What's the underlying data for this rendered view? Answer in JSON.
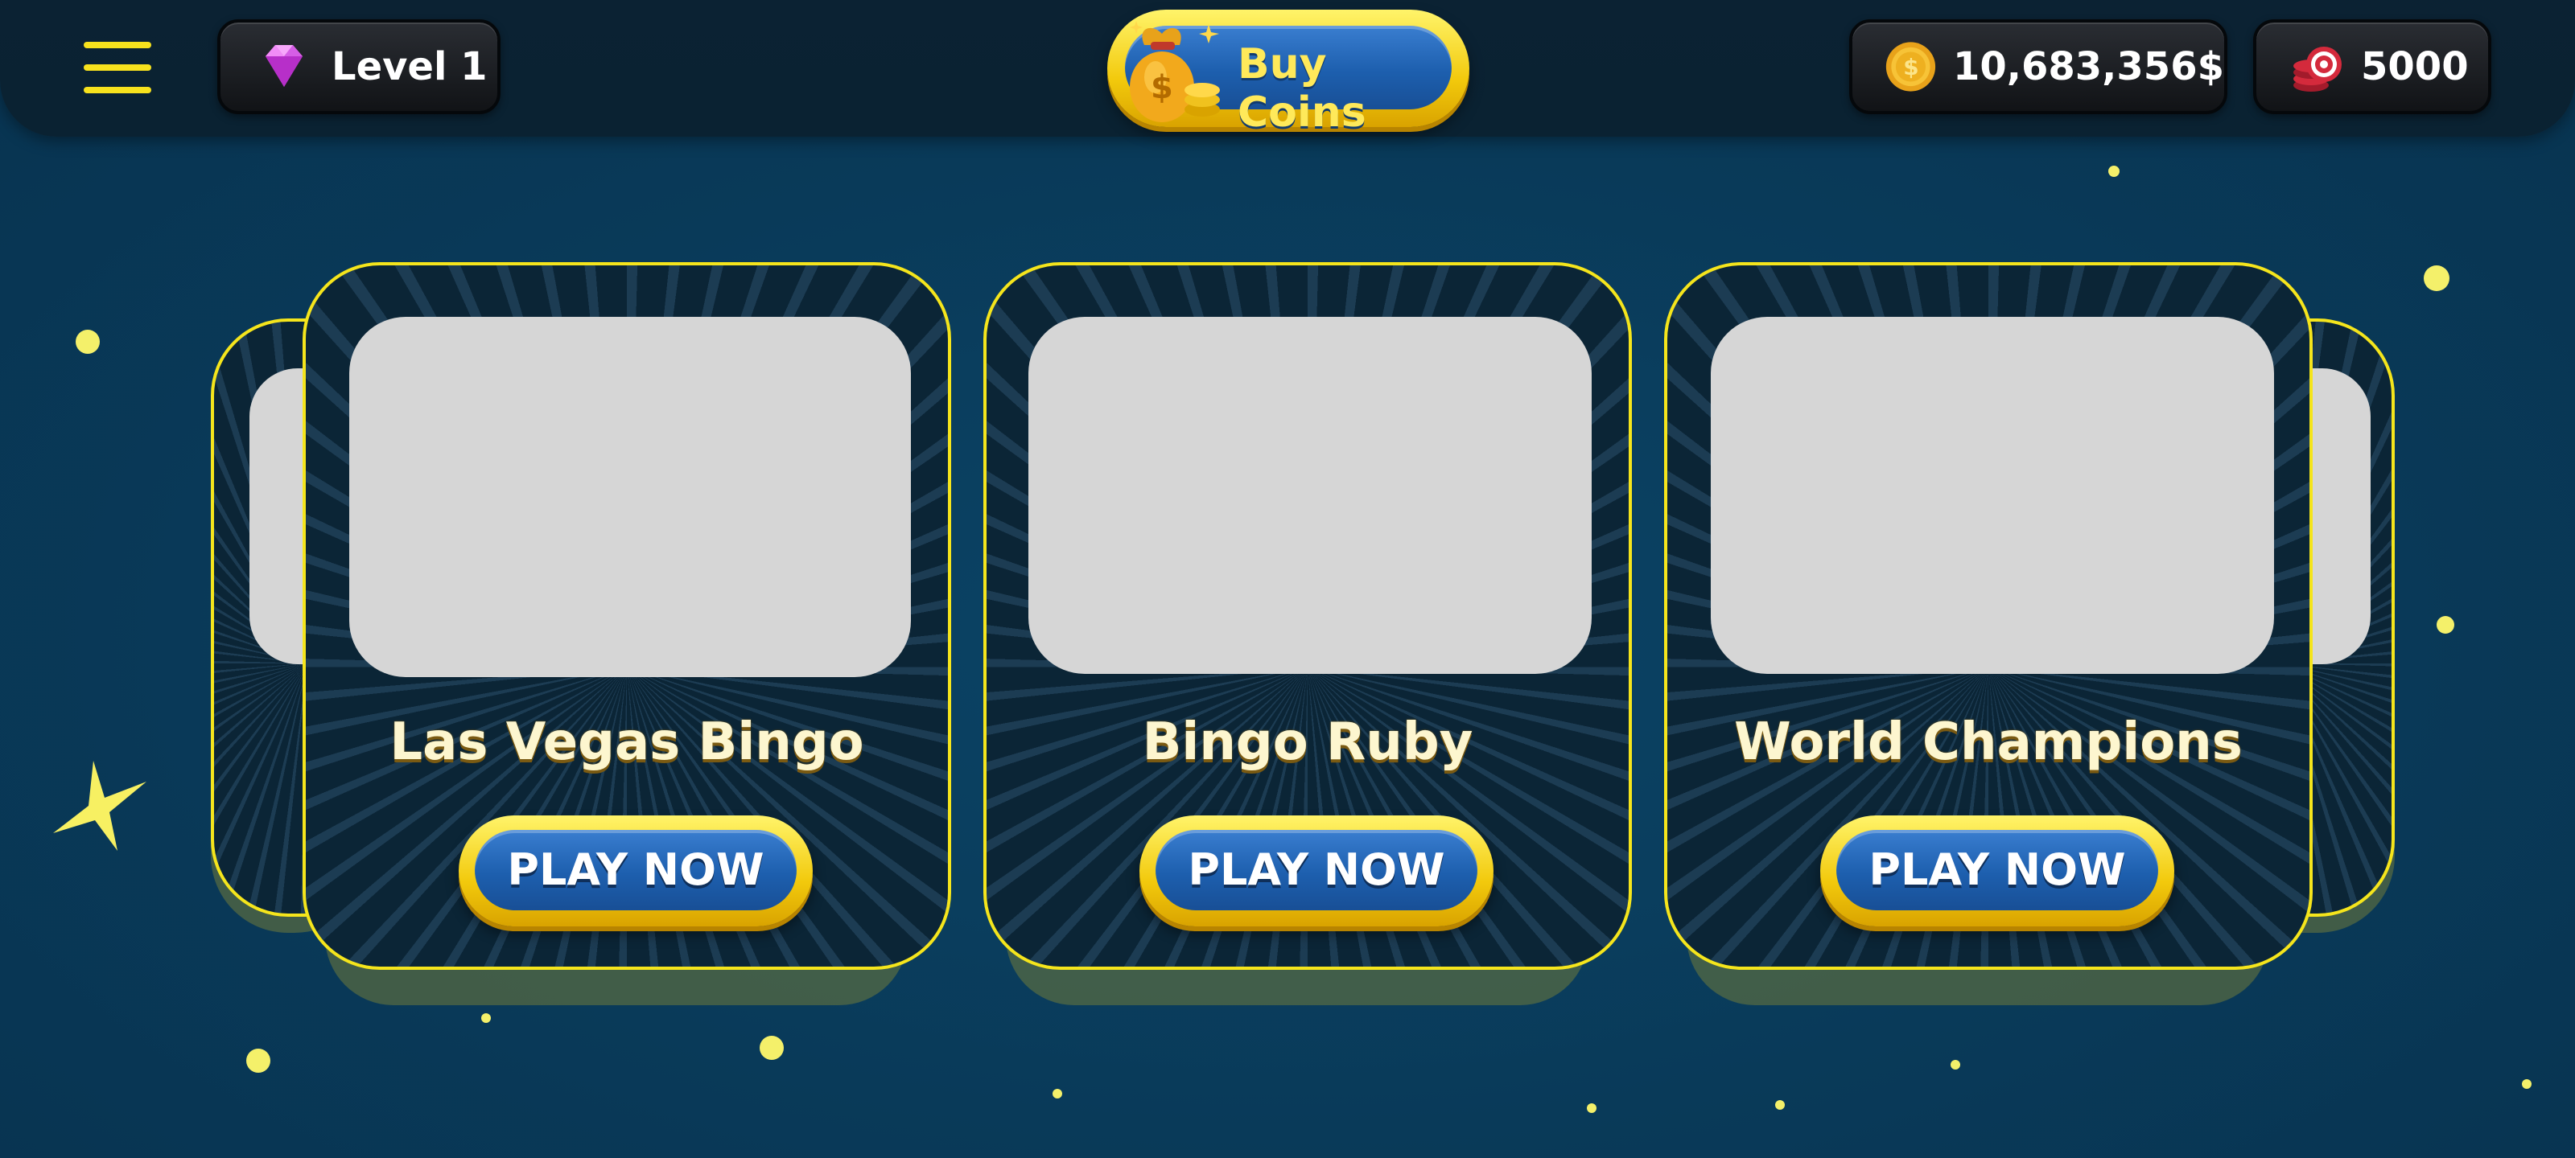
{
  "header": {
    "level_label": "Level 1",
    "buy_label": "Buy Coins",
    "coins_value": "10,683,356$",
    "chips_value": "5000"
  },
  "games": [
    {
      "title": "Las Vegas Bingo",
      "play_label": "PLAY NOW"
    },
    {
      "title": "Bingo Ruby",
      "play_label": "PLAY NOW"
    },
    {
      "title": "World Champions",
      "play_label": "PLAY NOW"
    }
  ],
  "icons": {
    "menu": "hamburger-menu-icon",
    "level": "gem-icon",
    "buy": "money-bag-icon",
    "coins": "gold-coin-icon",
    "chips": "casino-chips-icon"
  },
  "colors": {
    "accent_yellow": "#f5e51c",
    "button_blue": "#1d5fae",
    "background": "#093a59"
  }
}
